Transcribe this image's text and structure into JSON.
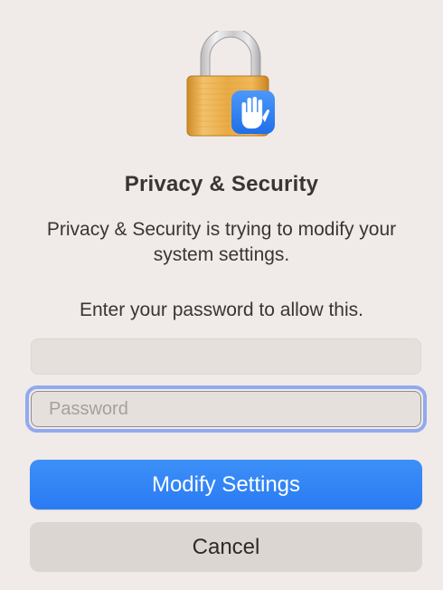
{
  "dialog": {
    "icon": "lock-with-hand-icon",
    "title": "Privacy & Security",
    "message": "Privacy & Security is trying to modify your system settings.",
    "prompt": "Enter your password to allow this.",
    "username_value": "",
    "password_placeholder": "Password",
    "primary_button": "Modify Settings",
    "secondary_button": "Cancel"
  },
  "colors": {
    "background": "#f0ebe8",
    "accent": "#2f80f5",
    "focus_ring": "#93a9ef",
    "lock_gold": "#e3a13b",
    "badge_blue": "#2f7df3"
  }
}
